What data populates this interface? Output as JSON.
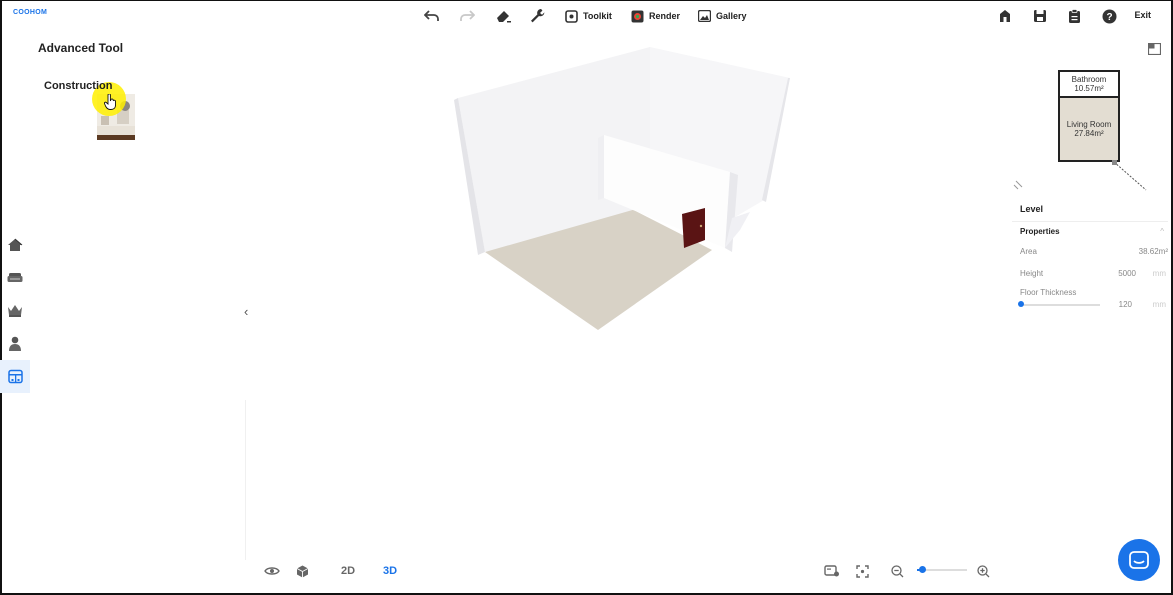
{
  "app": {
    "logo": "COOHOM"
  },
  "toolbar": {
    "toolkit_label": "Toolkit",
    "render_label": "Render",
    "gallery_label": "Gallery",
    "exit_label": "Exit",
    "icons": [
      "undo-icon",
      "redo-icon",
      "eraser-icon",
      "wrench-icon",
      "toolkit-icon",
      "render-icon",
      "gallery-icon",
      "home-icon",
      "save-icon",
      "clipboard-icon",
      "help-icon"
    ]
  },
  "left_panel": {
    "title": "Advanced Tool",
    "item_label": "Construction",
    "side_icons": [
      "house-icon",
      "sofa-icon",
      "crown-icon",
      "person-icon",
      "cabinet-icon"
    ],
    "active_side_icon": 4
  },
  "bottom_bar": {
    "view_2d": "2D",
    "view_3d": "3D",
    "active_view": "3D",
    "zoom_level": 0.1
  },
  "minimap": {
    "rooms": [
      {
        "name": "Bathroom",
        "area": "10.57m²"
      },
      {
        "name": "Living Room",
        "area": "27.84m²"
      }
    ]
  },
  "properties": {
    "section_level": "Level",
    "section_properties": "Properties",
    "area_label": "Area",
    "area_value": "38.62m²",
    "height_label": "Height",
    "height_value": "5000",
    "height_unit": "mm",
    "floor_thickness_label": "Floor Thickness",
    "floor_thickness_value": "120",
    "floor_thickness_unit": "mm"
  },
  "colors": {
    "accent": "#1a73e8",
    "floor": "#d8d2c6",
    "wall": "#f2f2f4",
    "door": "#5a1414"
  }
}
